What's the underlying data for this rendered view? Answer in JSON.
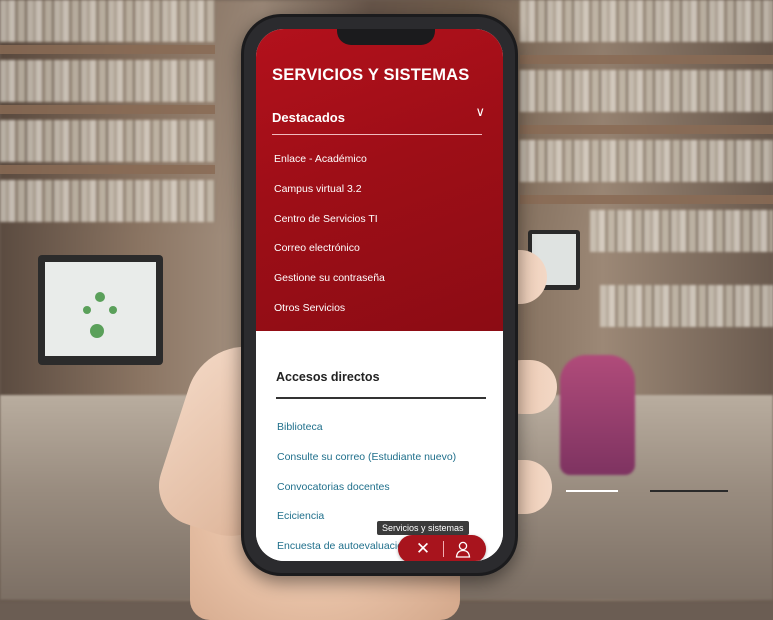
{
  "panel": {
    "title": "SERVICIOS Y SISTEMAS",
    "featured": {
      "label": "Destacados",
      "toggle_icon": "chevron-down-icon",
      "items": [
        "Enlace - Académico",
        "Campus virtual 3.2",
        "Centro de Servicios TI",
        "Correo electrónico",
        "Gestione su contraseña",
        "Otros Servicios"
      ]
    },
    "shortcuts": {
      "label": "Accesos directos",
      "items": [
        "Biblioteca",
        "Consulte su correo (Estudiante nuevo)",
        "Convocatorias docentes",
        "Eciciencia",
        "Encuesta de autoevaluación"
      ]
    }
  },
  "fab": {
    "tooltip": "Servicios y sistemas",
    "close_icon": "close-icon",
    "user_icon": "user-icon"
  },
  "colors": {
    "brand_red": "#9e0e17",
    "link_blue": "#1f6f8b"
  }
}
